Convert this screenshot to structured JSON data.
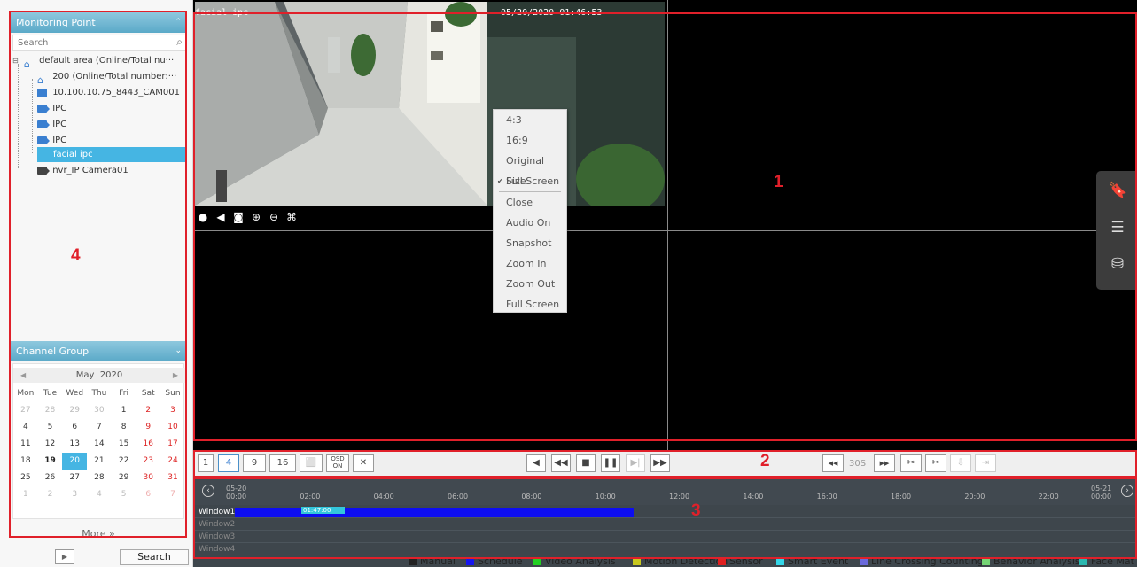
{
  "sidebar": {
    "monitoring_title": "Monitoring Point",
    "search_placeholder": "Search",
    "tree": [
      {
        "label": "default area (Online/Total nu···",
        "icon": "home-icon"
      },
      {
        "label": "200 (Online/Total number:···",
        "icon": "home-icon"
      },
      {
        "label": "10.100.10.75_8443_CAM001",
        "icon": "nvr-icon"
      },
      {
        "label": "IPC",
        "icon": "camera-icon"
      },
      {
        "label": "IPC",
        "icon": "camera-icon"
      },
      {
        "label": "IPC",
        "icon": "camera-icon"
      },
      {
        "label": "facial ipc",
        "icon": "none"
      },
      {
        "label": "nvr_IP Camera01",
        "icon": "camera-icon"
      }
    ],
    "channel_group_title": "Channel Group",
    "calendar": {
      "month": "May",
      "year": "2020",
      "weekdays": [
        "Mon",
        "Tue",
        "Wed",
        "Thu",
        "Fri",
        "Sat",
        "Sun"
      ],
      "weeks": [
        [
          "27",
          "28",
          "29",
          "30",
          "1",
          "2",
          "3"
        ],
        [
          "4",
          "5",
          "6",
          "7",
          "8",
          "9",
          "10"
        ],
        [
          "11",
          "12",
          "13",
          "14",
          "15",
          "16",
          "17"
        ],
        [
          "18",
          "19",
          "20",
          "21",
          "22",
          "23",
          "24"
        ],
        [
          "25",
          "26",
          "27",
          "28",
          "29",
          "30",
          "31"
        ],
        [
          "1",
          "2",
          "3",
          "4",
          "5",
          "6",
          "7"
        ]
      ],
      "selected_day": "20"
    },
    "more_label": "More »",
    "search_button": "Search"
  },
  "video": {
    "cam_title": "facial ipc",
    "cam_time": "05/20/2020 01:46:53",
    "context_menu": [
      "4:3",
      "16:9",
      "Original Size",
      "Full Screen",
      "Close",
      "Audio On",
      "Snapshot",
      "Zoom In",
      "Zoom Out",
      "Full Screen"
    ],
    "context_checked": "Full Screen"
  },
  "playback_bar": {
    "layout_buttons": [
      "1",
      "4",
      "9",
      "16"
    ],
    "osd_label": "OSD\nON",
    "skip_label": "30S"
  },
  "timeline": {
    "start_date": "05-20",
    "start_time": "00:00",
    "end_date": "05-21",
    "end_time": "00:00",
    "ticks": [
      "02:00",
      "04:00",
      "06:00",
      "08:00",
      "10:00",
      "12:00",
      "14:00",
      "16:00",
      "18:00",
      "20:00",
      "22:00"
    ],
    "rows": [
      "Window1",
      "Window2",
      "Window3",
      "Window4"
    ],
    "smart_event_label": "01:47:00"
  },
  "legend": [
    {
      "label": "Manual",
      "color": "#222222"
    },
    {
      "label": "Schedule",
      "color": "#1515f0"
    },
    {
      "label": "Video Analysis",
      "color": "#22d022"
    },
    {
      "label": "Motion Detection",
      "color": "#c8c81e"
    },
    {
      "label": "Sensor",
      "color": "#e02020"
    },
    {
      "label": "Smart Event",
      "color": "#33d6e8"
    },
    {
      "label": "Line Crossing Counting",
      "color": "#6a6adc"
    },
    {
      "label": "Behavior Analysis",
      "color": "#74d474"
    },
    {
      "label": "Face Mat",
      "color": "#2ab8b0"
    }
  ],
  "annotations": [
    "1",
    "2",
    "3",
    "4"
  ]
}
